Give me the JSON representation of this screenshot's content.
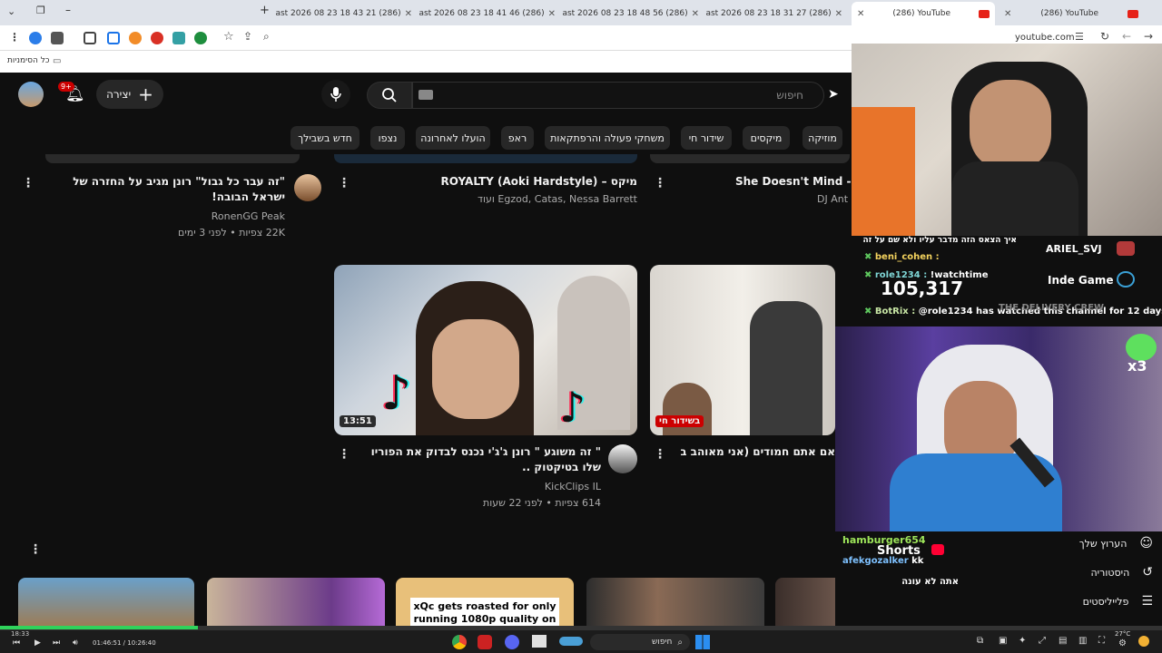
{
  "browser": {
    "tabs": [
      {
        "title": "(286) last 2026 08 23 18 43 21",
        "active": false
      },
      {
        "title": "(286) last 2026 08 23 18 41 46",
        "active": false
      },
      {
        "title": "(286) last 2026 08 23 18 48 56",
        "active": false
      },
      {
        "title": "(286) last 2026 08 23 18 31 27",
        "active": false
      },
      {
        "title": "(286) YouTube",
        "active": true
      },
      {
        "title": "(286) YouTube",
        "active": false
      }
    ],
    "url": "youtube.com",
    "bookmarks_label": "כל הסימניות"
  },
  "youtube": {
    "search_placeholder": "חיפוש",
    "create_label": "יצירה",
    "notification_count": "9+",
    "chips": [
      "מוזיקה",
      "מיקסים",
      "שידור חי",
      "משחקי פעולה והרפתקאות",
      "ראפ",
      "הועלו לאחרונה",
      "נצפו",
      "חדש בשבילך"
    ],
    "row1": [
      {
        "title": "\"זה עבר כל גבול\" רונן מגיב על החזרה של ישראל הבובה!",
        "channel": "RonenGG Peak",
        "stats": "22K צפיות • לפני 3 ימים"
      },
      {
        "title": "מיקס – ROYALTY (Aoki Hardstyle)",
        "channel": "Egzod, Catas, Nessa Barrett ועוד",
        "stats": ""
      },
      {
        "title": "She Doesn't Mind -",
        "channel": "DJ Ant",
        "stats": ""
      }
    ],
    "row2": [
      {
        "title": "\" זה משוגע \" רונן ג'ג'י נכנס לבדוק את הפוריו שלו בטיקטוק ..",
        "channel": "KickClips IL",
        "stats": "614 צפיות • לפני 22 שעות",
        "duration": "13:51"
      },
      {
        "title": "אם אתם חמודים (אני מאוהב בבן",
        "channel": "",
        "stats": "",
        "badge": "בשידור חי"
      }
    ],
    "row3_thumb_text": "xQc gets roasted for only running 1080p quality on his",
    "sidebar": [
      {
        "label": "הערוץ שלך"
      },
      {
        "label": "היסטוריה"
      },
      {
        "label": "פלייליסטים"
      }
    ]
  },
  "stream": {
    "view_count": "105,317",
    "chat": [
      {
        "user": "ARIEL_SVJ",
        "text": "איך הצאס הזה מדבר עליו ולא שם על זה"
      },
      {
        "user": "beni_cohen",
        "text": ""
      },
      {
        "user": "Inde Game",
        "text": ""
      },
      {
        "user": "role1234",
        "text": "!watchtime"
      },
      {
        "user": "BotRix",
        "text": "@role1234 has watched this channel for 12 days 12"
      },
      {
        "user": "hamburger654",
        "text": ""
      },
      {
        "user": "afekgozalker",
        "text": "kk"
      },
      {
        "user": "",
        "text": "אתה לא עונה"
      }
    ],
    "shorts_label": "Shorts",
    "overlay_tag": "THE DELIVERY CREW",
    "multiplier": "x3"
  },
  "player": {
    "time": "01:46:51 / 10:26:40",
    "clock": "18:33"
  },
  "taskbar": {
    "search_label": "חיפוש",
    "weather": "27°C"
  },
  "colors": {
    "youtube_red": "#ff0000",
    "chip_bg": "#272727",
    "bg": "#0f0f0f",
    "chat_green": "#9ee65a"
  }
}
